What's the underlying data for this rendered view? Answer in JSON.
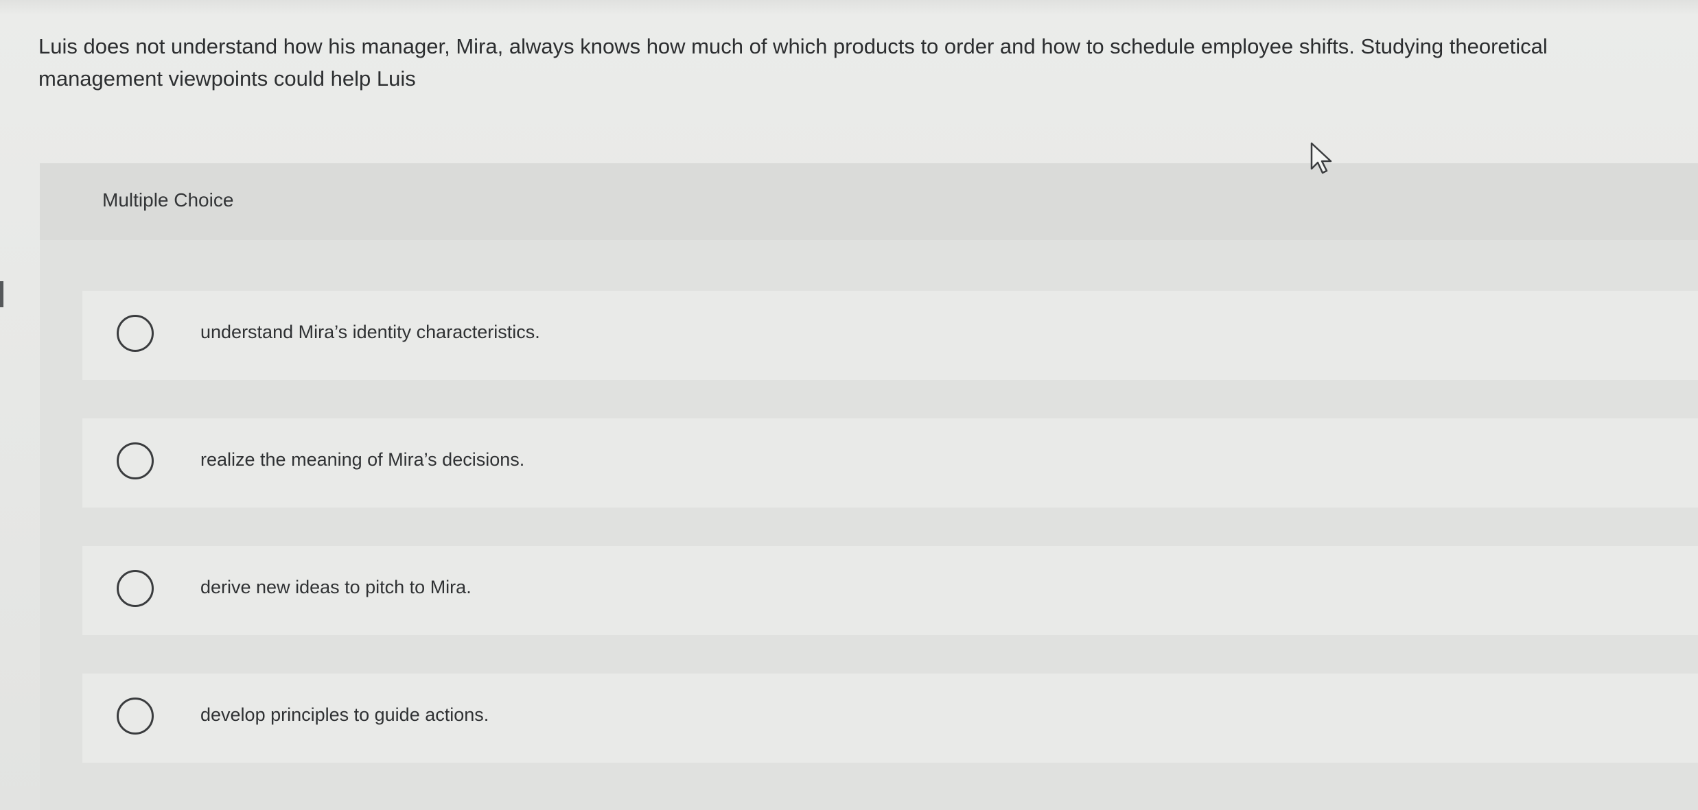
{
  "question": {
    "text": "Luis does not understand how his manager, Mira, always knows how much of which products to order and how to schedule employee shifts. Studying theoretical management viewpoints could help Luis"
  },
  "panel": {
    "type_label": "Multiple Choice"
  },
  "options": [
    {
      "label": "understand Mira’s identity characteristics."
    },
    {
      "label": "realize the meaning of Mira’s decisions."
    },
    {
      "label": "derive new ideas to pitch to Mira."
    },
    {
      "label": "develop principles to guide actions."
    }
  ],
  "icons": {
    "cursor": "mouse-pointer-icon",
    "radio": "radio-circle-icon"
  },
  "colors": {
    "background": "#e7e8e6",
    "panel": "#e0e1df",
    "option_row": "#e9eae8",
    "text": "#2c2e30"
  }
}
